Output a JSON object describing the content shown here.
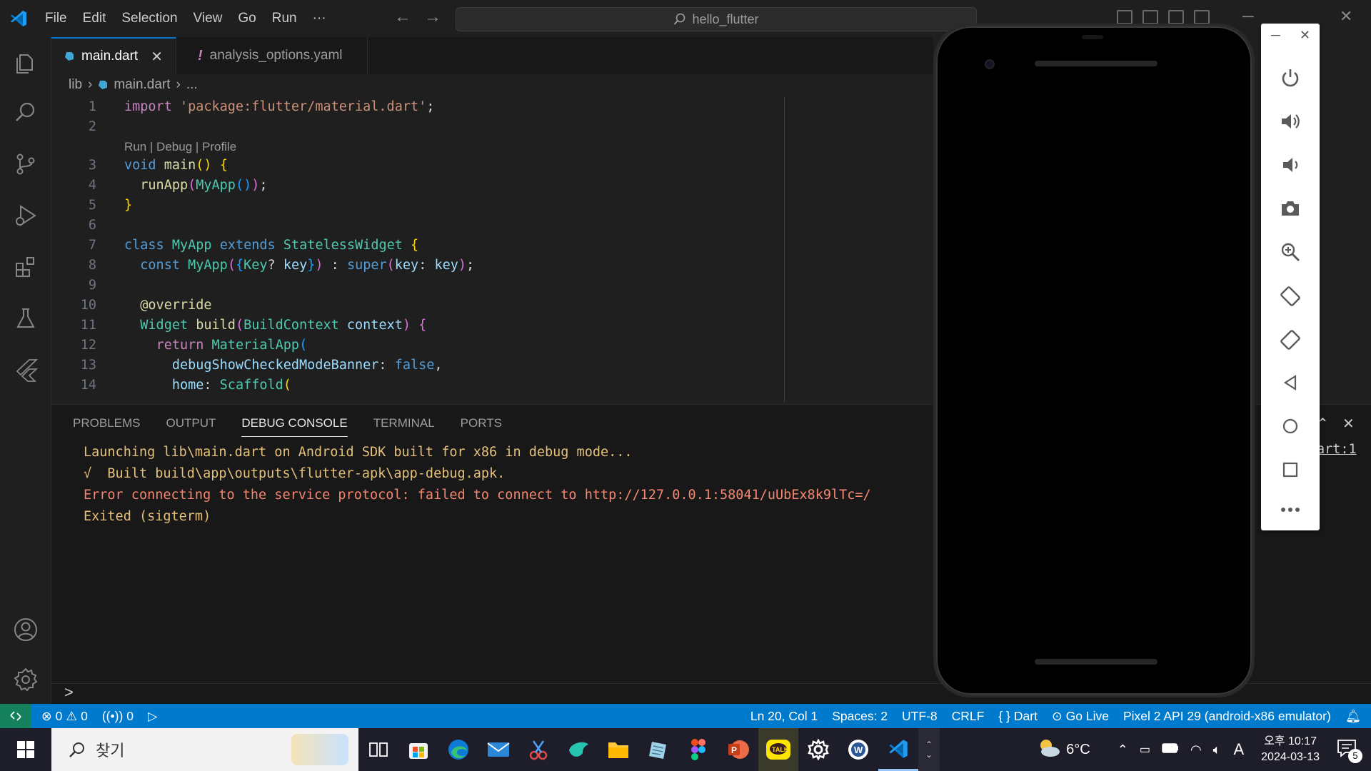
{
  "menu": [
    "File",
    "Edit",
    "Selection",
    "View",
    "Go",
    "Run",
    "···"
  ],
  "search": {
    "label": "hello_flutter"
  },
  "tabs": [
    {
      "label": "main.dart",
      "active": true
    },
    {
      "label": "analysis_options.yaml",
      "active": false
    }
  ],
  "breadcrumb": {
    "folder": "lib",
    "file": "main.dart",
    "more": "..."
  },
  "codelens": "Run | Debug | Profile",
  "code_lines": [
    "1",
    "2",
    "3",
    "4",
    "5",
    "6",
    "7",
    "8",
    "9",
    "10",
    "11",
    "12",
    "13",
    "14"
  ],
  "panel": {
    "tabs": [
      "PROBLEMS",
      "OUTPUT",
      "DEBUG CONSOLE",
      "TERMINAL",
      "PORTS"
    ],
    "active_tab": "DEBUG CONSOLE",
    "console": [
      "Launching lib\\main.dart on Android SDK built for x86 in debug mode...",
      "√  Built build\\app\\outputs\\flutter-apk\\app-debug.apk.",
      "Error connecting to the service protocol: failed to connect to http://127.0.0.1:58041/uUbEx8k9lTc=/",
      "Exited (sigterm)"
    ],
    "side_link": "art:1",
    "prompt": ">"
  },
  "statusbar": {
    "errors": "0",
    "warnings": "0",
    "ports": "0",
    "position": "Ln 20, Col 1",
    "spaces": "Spaces: 2",
    "encoding": "UTF-8",
    "eol": "CRLF",
    "language": "Dart",
    "golive": "Go Live",
    "device": "Pixel 2 API 29 (android-x86 emulator)"
  },
  "taskbar": {
    "search_label": "찾기",
    "weather": "6°C",
    "ime": "A",
    "ampm_time": "오후 10:17",
    "date": "2024-03-13",
    "notif_count": "5"
  },
  "colors": {
    "accent": "#007acc",
    "remote": "#16825d",
    "error_text": "#f48771",
    "info_text": "#e5c07b"
  }
}
